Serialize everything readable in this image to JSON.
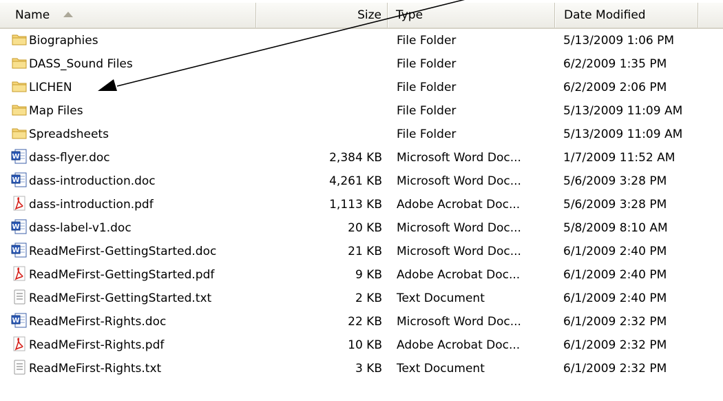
{
  "columns": {
    "name": "Name",
    "size": "Size",
    "type": "Type",
    "date": "Date Modified"
  },
  "files": [
    {
      "name": "Biographies",
      "size": "",
      "type": "File Folder",
      "date": "5/13/2009 1:06 PM",
      "icon": "folder-icon"
    },
    {
      "name": "DASS_Sound Files",
      "size": "",
      "type": "File Folder",
      "date": "6/2/2009 1:35 PM",
      "icon": "folder-icon"
    },
    {
      "name": "LICHEN",
      "size": "",
      "type": "File Folder",
      "date": "6/2/2009 2:06 PM",
      "icon": "folder-icon"
    },
    {
      "name": "Map Files",
      "size": "",
      "type": "File Folder",
      "date": "5/13/2009 11:09 AM",
      "icon": "folder-icon"
    },
    {
      "name": "Spreadsheets",
      "size": "",
      "type": "File Folder",
      "date": "5/13/2009 11:09 AM",
      "icon": "folder-icon"
    },
    {
      "name": "dass-flyer.doc",
      "size": "2,384 KB",
      "type": "Microsoft Word Doc...",
      "date": "1/7/2009 11:52 AM",
      "icon": "word-doc-icon"
    },
    {
      "name": "dass-introduction.doc",
      "size": "4,261 KB",
      "type": "Microsoft Word Doc...",
      "date": "5/6/2009 3:28 PM",
      "icon": "word-doc-icon"
    },
    {
      "name": "dass-introduction.pdf",
      "size": "1,113 KB",
      "type": "Adobe Acrobat Doc...",
      "date": "5/6/2009 3:28 PM",
      "icon": "pdf-icon"
    },
    {
      "name": "dass-label-v1.doc",
      "size": "20 KB",
      "type": "Microsoft Word Doc...",
      "date": "5/8/2009 8:10 AM",
      "icon": "word-doc-icon"
    },
    {
      "name": "ReadMeFirst-GettingStarted.doc",
      "size": "21 KB",
      "type": "Microsoft Word Doc...",
      "date": "6/1/2009 2:40 PM",
      "icon": "word-doc-icon"
    },
    {
      "name": "ReadMeFirst-GettingStarted.pdf",
      "size": "9 KB",
      "type": "Adobe Acrobat Doc...",
      "date": "6/1/2009 2:40 PM",
      "icon": "pdf-icon"
    },
    {
      "name": "ReadMeFirst-GettingStarted.txt",
      "size": "2 KB",
      "type": "Text Document",
      "date": "6/1/2009 2:40 PM",
      "icon": "text-doc-icon"
    },
    {
      "name": "ReadMeFirst-Rights.doc",
      "size": "22 KB",
      "type": "Microsoft Word Doc...",
      "date": "6/1/2009 2:32 PM",
      "icon": "word-doc-icon"
    },
    {
      "name": "ReadMeFirst-Rights.pdf",
      "size": "10 KB",
      "type": "Adobe Acrobat Doc...",
      "date": "6/1/2009 2:32 PM",
      "icon": "pdf-icon"
    },
    {
      "name": "ReadMeFirst-Rights.txt",
      "size": "3 KB",
      "type": "Text Document",
      "date": "6/1/2009 2:32 PM",
      "icon": "text-doc-icon"
    }
  ],
  "annotation": {
    "points_to": "LICHEN",
    "color": "#000000"
  }
}
